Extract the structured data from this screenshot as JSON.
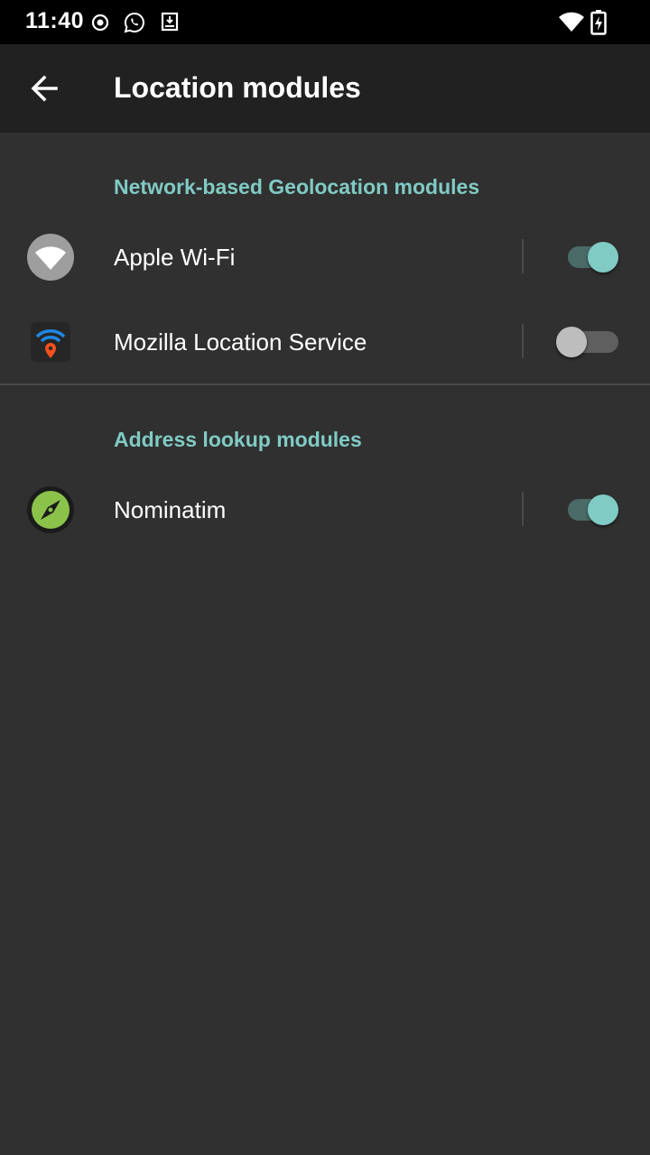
{
  "status_bar": {
    "time": "11:40"
  },
  "app_bar": {
    "title": "Location modules"
  },
  "sections": [
    {
      "header": "Network-based Geolocation modules",
      "items": [
        {
          "label": "Apple Wi-Fi",
          "enabled": true,
          "icon": "apple-wifi-icon"
        },
        {
          "label": "Mozilla Location Service",
          "enabled": false,
          "icon": "mozilla-location-icon"
        }
      ]
    },
    {
      "header": "Address lookup modules",
      "items": [
        {
          "label": "Nominatim",
          "enabled": true,
          "icon": "nominatim-compass-icon"
        }
      ]
    }
  ],
  "colors": {
    "accent": "#80cbc4",
    "background": "#303030",
    "app_bar": "#212121"
  }
}
